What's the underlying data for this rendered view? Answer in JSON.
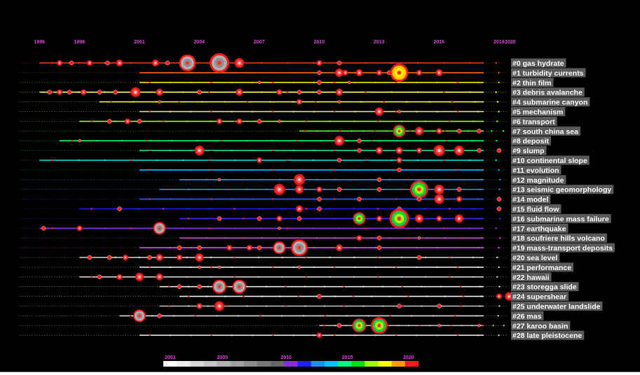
{
  "chart_data": {
    "type": "timeline",
    "title": "",
    "timeline_years": [
      "1996",
      "1998",
      "2001",
      "2004",
      "2007",
      "2010",
      "2013",
      "2016",
      "2019",
      "2020"
    ],
    "year_color": "#e040e0",
    "legend": {
      "labels": [
        "2001",
        "2005",
        "2010",
        "2015",
        "2020"
      ],
      "colors": [
        "#ffffff",
        "#ececec",
        "#d9d9d9",
        "#c6c6c6",
        "#b3b3b3",
        "#a0a0a0",
        "#8d8d8d",
        "#7a7a7a",
        "#676767",
        "#8a2be2",
        "#1e22ff",
        "#1e90ff",
        "#00c8ff",
        "#00ff7f",
        "#00e000",
        "#a0ff00",
        "#ffff00",
        "#ffa000",
        "#ff1a1a"
      ]
    },
    "clusters": [
      {
        "label": "#0 gas hydrate",
        "color": "#ff3a1a",
        "start": 1996,
        "nodes": [
          [
            1997,
            4
          ],
          [
            1997.6,
            3
          ],
          [
            1998.5,
            4
          ],
          [
            1999.4,
            3
          ],
          [
            2000,
            5
          ],
          [
            2001.8,
            5
          ],
          [
            2002.4,
            3
          ],
          [
            2003.4,
            12
          ],
          [
            2005,
            14
          ],
          [
            2006,
            7
          ],
          [
            2010,
            4
          ],
          [
            2011,
            3
          ]
        ]
      },
      {
        "label": "#1 turbidity currents",
        "color": "#ff6a00",
        "start": 2001,
        "nodes": [
          [
            2010,
            3
          ],
          [
            2011,
            6
          ],
          [
            2011.3,
            4
          ],
          [
            2012,
            5
          ],
          [
            2013,
            4
          ],
          [
            2013.5,
            3
          ],
          [
            2014,
            13
          ],
          [
            2015,
            4
          ],
          [
            2016,
            5
          ]
        ]
      },
      {
        "label": "#2 thin film",
        "color": "#ffd800",
        "start": 2001,
        "nodes": [
          [
            2007,
            2
          ],
          [
            2010,
            3
          ],
          [
            2011.5,
            2
          ]
        ]
      },
      {
        "label": "#3 debris avalanche",
        "color": "#ffff60",
        "start": 1996,
        "nodes": [
          [
            1996.5,
            3
          ],
          [
            1997,
            4
          ],
          [
            1997.5,
            3
          ],
          [
            1998.2,
            4
          ],
          [
            1999,
            3
          ],
          [
            1999.8,
            3
          ],
          [
            2000.8,
            7
          ],
          [
            2002,
            5
          ],
          [
            2004,
            3
          ],
          [
            2006,
            5
          ],
          [
            2008,
            4
          ],
          [
            2009,
            3
          ],
          [
            2010,
            3
          ],
          [
            2011,
            5
          ]
        ]
      },
      {
        "label": "#4 submarine canyon",
        "color": "#ffff40",
        "start": 1999,
        "nodes": [
          [
            2002,
            2
          ],
          [
            2009,
            4
          ],
          [
            2011,
            2
          ]
        ]
      },
      {
        "label": "#5 mechanism",
        "color": "#f2ff30",
        "start": 2001,
        "nodes": [
          [
            2013,
            6
          ],
          [
            2014,
            2
          ]
        ]
      },
      {
        "label": "#6 transport",
        "color": "#a8ff00",
        "start": 1998,
        "nodes": [
          [
            1999.5,
            3
          ],
          [
            2000.4,
            4
          ],
          [
            2001,
            3
          ],
          [
            2005,
            4
          ],
          [
            2006,
            4
          ],
          [
            2007,
            3
          ],
          [
            2008,
            2
          ]
        ]
      },
      {
        "label": "#7 south china sea",
        "color": "#60f040",
        "start": 2009,
        "nodes": [
          [
            2014,
            9
          ],
          [
            2015,
            6
          ],
          [
            2016,
            4
          ],
          [
            2017,
            3
          ],
          [
            2018,
            3
          ]
        ]
      },
      {
        "label": "#8 deposit",
        "color": "#00ff80",
        "start": 1997,
        "nodes": [
          [
            1998,
            2
          ],
          [
            2011,
            7
          ],
          [
            2012,
            3
          ]
        ]
      },
      {
        "label": "#9 slump",
        "color": "#00e6a0",
        "start": 2001,
        "nodes": [
          [
            2004,
            7
          ],
          [
            2012,
            3
          ],
          [
            2013,
            5
          ],
          [
            2014,
            5
          ],
          [
            2015,
            4
          ],
          [
            2016,
            8
          ],
          [
            2017,
            7
          ],
          [
            2018,
            3
          ],
          [
            2019,
            3
          ]
        ]
      },
      {
        "label": "#10 continental slope",
        "color": "#00e8e8",
        "start": 1996,
        "nodes": [
          [
            2007,
            4
          ],
          [
            2011,
            3
          ],
          [
            2014,
            4
          ]
        ]
      },
      {
        "label": "#11 evolution",
        "color": "#00c8ff",
        "start": 2001,
        "nodes": [
          [
            2014,
            3
          ]
        ]
      },
      {
        "label": "#12 magnitude",
        "color": "#00a8ff",
        "start": 2003,
        "nodes": [
          [
            2005,
            2
          ],
          [
            2009,
            8
          ],
          [
            2013,
            3
          ]
        ]
      },
      {
        "label": "#13 seismic geomorphology",
        "color": "#1e90ff",
        "start": 2002,
        "nodes": [
          [
            2008,
            8
          ],
          [
            2009,
            6
          ],
          [
            2010,
            4
          ],
          [
            2011,
            3
          ],
          [
            2013,
            3
          ],
          [
            2015,
            13
          ],
          [
            2016,
            7
          ],
          [
            2017,
            3
          ]
        ]
      },
      {
        "label": "#14 model",
        "color": "#2860ff",
        "start": 2001,
        "nodes": [
          [
            2010,
            3
          ],
          [
            2012,
            3
          ],
          [
            2015,
            3
          ],
          [
            2016,
            7
          ],
          [
            2017,
            4
          ],
          [
            2019,
            3
          ]
        ]
      },
      {
        "label": "#15 fluid flow",
        "color": "#1e22ff",
        "start": 1998,
        "nodes": [
          [
            2000,
            3
          ],
          [
            2009,
            5
          ],
          [
            2010,
            3
          ],
          [
            2014,
            3
          ],
          [
            2019,
            3
          ]
        ]
      },
      {
        "label": "#16 submarine mass failure",
        "color": "#4b28ff",
        "start": 2003,
        "nodes": [
          [
            2005,
            3
          ],
          [
            2007,
            3
          ],
          [
            2008,
            4
          ],
          [
            2009,
            3
          ],
          [
            2012,
            9
          ],
          [
            2013,
            4
          ],
          [
            2014,
            14
          ],
          [
            2015,
            6
          ],
          [
            2016,
            4
          ],
          [
            2017,
            6
          ]
        ]
      },
      {
        "label": "#17 earthquake",
        "color": "#9a28e8",
        "start": 1996,
        "nodes": [
          [
            1996.2,
            3
          ],
          [
            1998,
            4
          ],
          [
            2002,
            9
          ],
          [
            2008,
            2
          ]
        ]
      },
      {
        "label": "#18 soufriere hills volcano",
        "color": "#d040e0",
        "start": 2003,
        "nodes": [
          [
            2012,
            4
          ],
          [
            2013,
            3
          ],
          [
            2015,
            2
          ]
        ]
      },
      {
        "label": "#19 mass-transport deposits",
        "color": "#ff40ff",
        "start": 2001,
        "nodes": [
          [
            2003,
            3
          ],
          [
            2004,
            3
          ],
          [
            2005.5,
            4
          ],
          [
            2006.5,
            4
          ],
          [
            2007,
            3
          ],
          [
            2008,
            9
          ],
          [
            2009,
            12
          ],
          [
            2011,
            5
          ],
          [
            2013,
            3
          ]
        ]
      },
      {
        "label": "#20 sea level",
        "color": "#d8d8d8",
        "start": 1998,
        "nodes": [
          [
            1998.5,
            3
          ],
          [
            1999.5,
            3
          ],
          [
            2000.3,
            4
          ],
          [
            2001.5,
            3
          ],
          [
            2002,
            5
          ],
          [
            2003,
            4
          ],
          [
            2004,
            6
          ],
          [
            2015,
            3
          ]
        ]
      },
      {
        "label": "#21 performance",
        "color": "#e8e8e8",
        "start": 2001,
        "nodes": [
          [
            2004,
            2
          ],
          [
            2005,
            2
          ],
          [
            2009,
            2
          ]
        ]
      },
      {
        "label": "#22 hawaii",
        "color": "#cfcfcf",
        "start": 1998,
        "nodes": [
          [
            1999,
            3
          ],
          [
            2000,
            4
          ],
          [
            2001,
            6
          ],
          [
            2002,
            5
          ]
        ]
      },
      {
        "label": "#23 storegga slide",
        "color": "#e6e6e6",
        "start": 2002,
        "nodes": [
          [
            2003,
            3
          ],
          [
            2004,
            3
          ],
          [
            2005,
            10
          ],
          [
            2006,
            10
          ]
        ]
      },
      {
        "label": "#24 supershear",
        "color": "#f0f0f0",
        "start": 2003,
        "nodes": [
          [
            2010,
            3
          ],
          [
            2019,
            4
          ],
          [
            2019.5,
            6
          ]
        ]
      },
      {
        "label": "#25 underwater landslide",
        "color": "#c9c9c9",
        "start": 2002,
        "nodes": [
          [
            2004,
            4
          ],
          [
            2005,
            7
          ],
          [
            2014,
            3
          ],
          [
            2016,
            3
          ]
        ]
      },
      {
        "label": "#26 mas",
        "color": "#dcdcdc",
        "start": 2000,
        "nodes": [
          [
            2001,
            9
          ],
          [
            2002,
            3
          ]
        ]
      },
      {
        "label": "#27 karoo basin",
        "color": "#c0c0c0",
        "start": 2010,
        "nodes": [
          [
            2011,
            3
          ],
          [
            2012,
            10
          ],
          [
            2013,
            12
          ],
          [
            2016,
            2
          ],
          [
            2018,
            2
          ]
        ]
      },
      {
        "label": "#28 late pleistocene",
        "color": "#e0e0e0",
        "start": 2001,
        "nodes": [
          [
            2010,
            4
          ]
        ]
      }
    ]
  }
}
